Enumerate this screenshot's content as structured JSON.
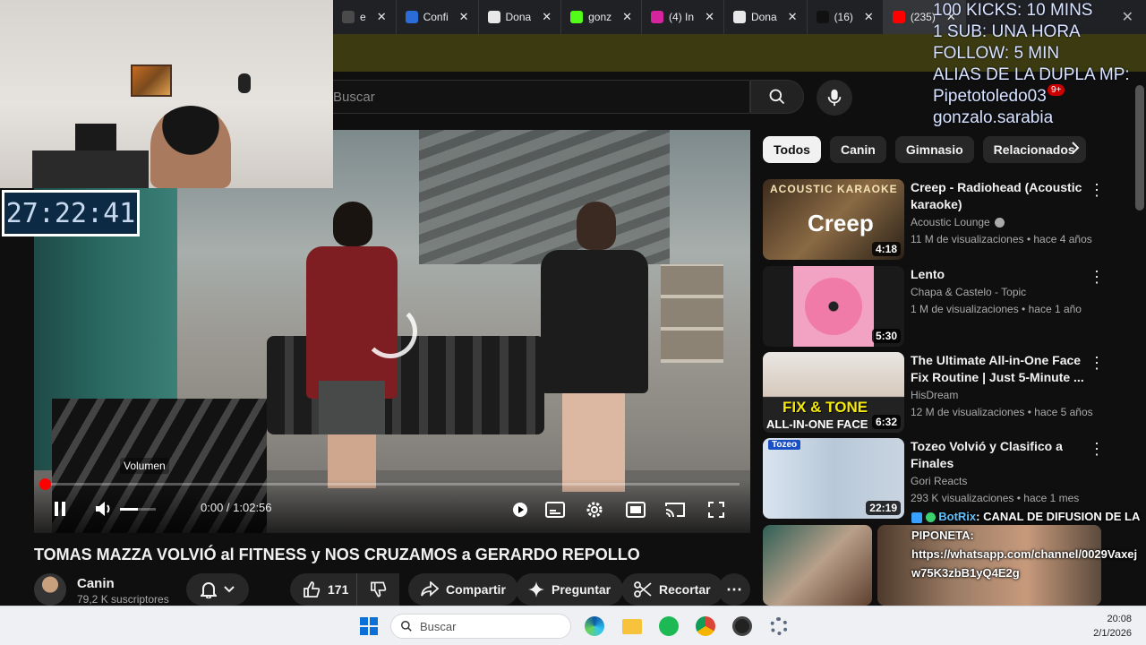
{
  "browser": {
    "tabs": [
      {
        "label": "e",
        "color": "#4a4a4a",
        "active": false
      },
      {
        "label": "Confi",
        "color": "#2b6cd6",
        "active": false
      },
      {
        "label": "Dona",
        "color": "#e8e8e8",
        "active": false
      },
      {
        "label": "gonz",
        "color": "#53fc18",
        "active": false
      },
      {
        "label": "(4) In",
        "color": "#d6249f",
        "active": false
      },
      {
        "label": "Dona",
        "color": "#e8e8e8",
        "active": false
      },
      {
        "label": "(16)",
        "color": "#111111",
        "active": false
      },
      {
        "label": "(235)",
        "color": "#ff0000",
        "active": true
      }
    ],
    "tab_close_glyph": "✕",
    "window_close_glyph": "✕"
  },
  "youtube": {
    "search_placeholder": "Buscar",
    "notification_count": "9+"
  },
  "timer": "27:22:41",
  "player": {
    "tooltip": "Volumen",
    "time": "0:00 / 1:02:56",
    "progress_fraction": 0.0,
    "volume_fraction": 0.5
  },
  "video": {
    "title": "TOMAS MAZZA VOLVIÓ al FITNESS y NOS CRUZAMOS a GERARDO REPOLLO",
    "channel": "Canin",
    "subscribers": "79,2 K suscriptores",
    "likes": "171",
    "share_label": "Compartir",
    "ask_label": "Preguntar",
    "clip_label": "Recortar"
  },
  "sidebar": {
    "chips": [
      "Todos",
      "Canin",
      "Gimnasio",
      "Relacionados"
    ],
    "recommendations": [
      {
        "title": "Creep - Radiohead (Acoustic karaoke)",
        "channel": "Acoustic Lounge",
        "verified": true,
        "meta": "11 M de visualizaciones • hace 4 años",
        "duration": "4:18",
        "thumb_text": "Creep",
        "thumb_caption": "ACOUSTIC KARAOKE"
      },
      {
        "title": "Lento",
        "channel": "Chapa & Castelo - Topic",
        "verified": false,
        "meta": "1 M de visualizaciones • hace 1 año",
        "duration": "5:30",
        "thumb_text": "",
        "thumb_caption": ""
      },
      {
        "title": "The Ultimate All-in-One Face Fix Routine | Just 5-Minute ...",
        "channel": "HisDream",
        "verified": false,
        "meta": "12 M de visualizaciones • hace 5 años",
        "duration": "6:32",
        "thumb_text": "FIX & TONE",
        "thumb_caption": "ALL-IN-ONE FACE"
      },
      {
        "title": "Tozeo Volvió y Clasifico a Finales",
        "channel": "Gori Reacts",
        "verified": false,
        "meta": "293 K visualizaciones • hace 1 mes",
        "duration": "22:19",
        "thumb_text": "",
        "thumb_caption": "Tozeo"
      }
    ]
  },
  "overlay": {
    "lines": [
      "100 KICKS: 10 MINS",
      "1 SUB: UNA HORA",
      "FOLLOW: 5 MIN",
      "ALIAS DE LA DUPLA MP:",
      "Pipetotoledo03",
      "gonzalo.sarabia"
    ]
  },
  "chat": {
    "user": "BotRix",
    "message_prefix": ": CANAL DE DIFUSION DE LA PIPONETA:",
    "link": "https://whatsapp.com/channel/0029Vaxejw75K3zbB1yQ4E2g"
  },
  "taskbar": {
    "search_label": "Buscar",
    "time": "20:08",
    "date": "2/1/2026"
  },
  "colors": {
    "accent": "#ff0000",
    "bg": "#0f0f0f",
    "address_bar": "#3b3a11",
    "timer_bg": "#0d2a44"
  }
}
